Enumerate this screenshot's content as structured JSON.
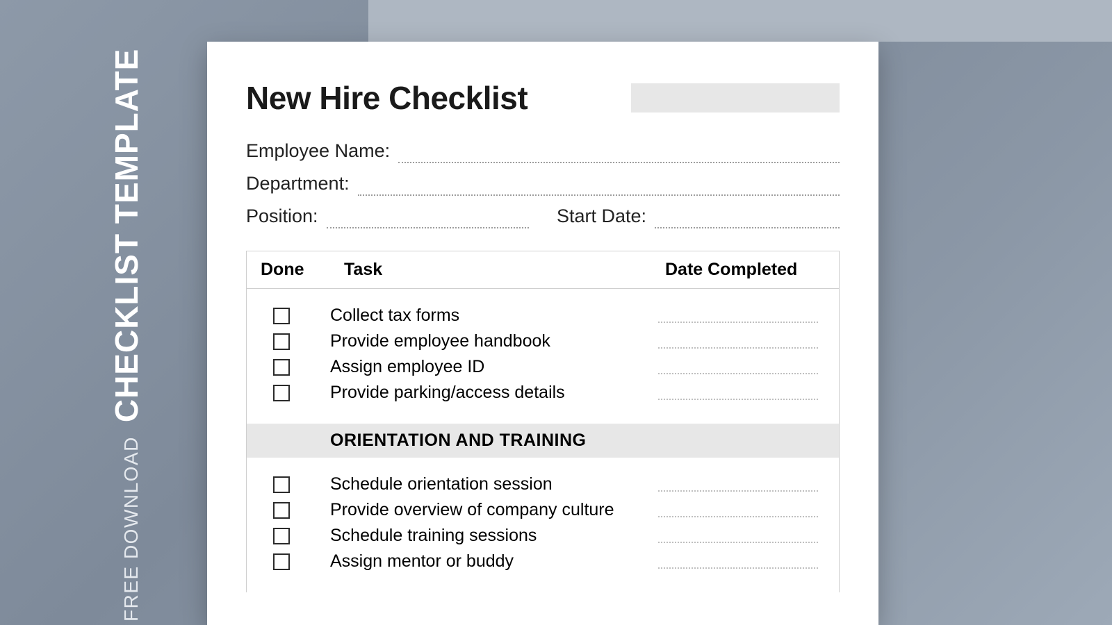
{
  "sidebar": {
    "small": "FREE DOWNLOAD",
    "big": "CHECKLIST TEMPLATE"
  },
  "doc": {
    "title": "New Hire Checklist",
    "fields": {
      "employee_name": "Employee Name:",
      "department": "Department:",
      "position": "Position:",
      "start_date": "Start Date:"
    },
    "columns": {
      "done": "Done",
      "task": "Task",
      "date": "Date Completed"
    },
    "section1_tasks": [
      "Collect tax forms",
      "Provide employee handbook",
      "Assign employee ID",
      "Provide parking/access details"
    ],
    "group_header": "ORIENTATION AND TRAINING",
    "section2_tasks": [
      "Schedule orientation session",
      "Provide overview of company culture",
      "Schedule training sessions",
      "Assign mentor or buddy"
    ]
  }
}
